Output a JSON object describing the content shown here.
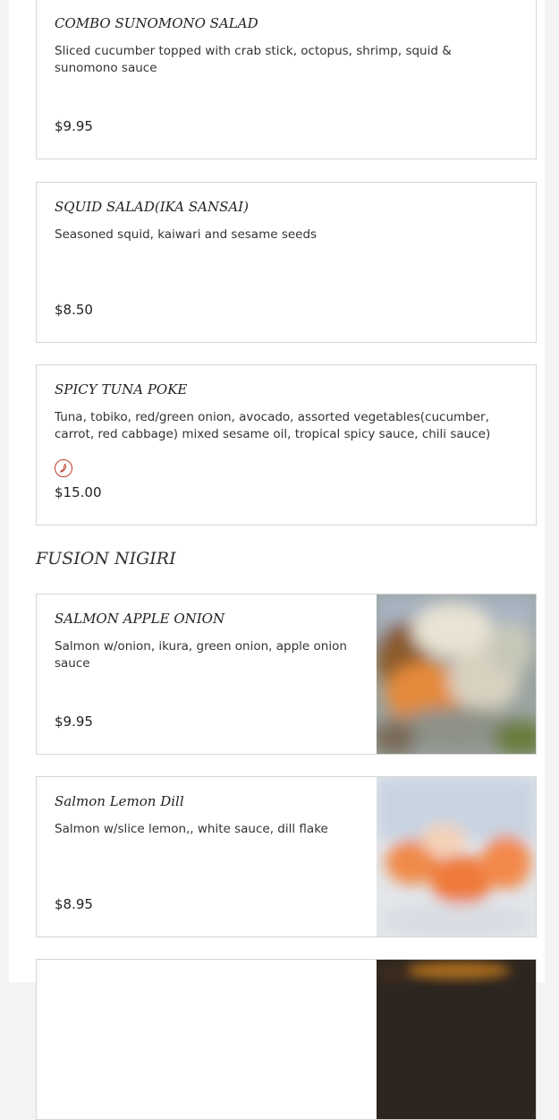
{
  "menu": {
    "items": [
      {
        "title": "COMBO SUNOMONO SALAD",
        "description": "Sliced cucumber topped with crab stick, octopus, shrimp, squid & sunomono sauce",
        "price": "$9.95"
      },
      {
        "title": "SQUID SALAD(IKA SANSAI)",
        "description": "Seasoned squid, kaiwari and sesame seeds",
        "price": "$8.50"
      },
      {
        "title": "SPICY TUNA POKE",
        "description": "Tuna, tobiko, red/green onion, avocado, assorted vegetables(cucumber, carrot, red cabbage) mixed sesame oil, tropical spicy sauce, chili sauce)",
        "price": "$15.00",
        "icon": "spicy-pepper-icon"
      }
    ],
    "section": {
      "title": "FUSION NIGIRI",
      "items": [
        {
          "title": "SALMON APPLE ONION",
          "description": "Salmon w/onion, ikura, green onion, apple onion sauce",
          "price": "$9.95"
        },
        {
          "title": "Salmon Lemon Dill",
          "description": "Salmon w/slice lemon,, white sauce, dill flake",
          "price": "$8.95"
        },
        {
          "title": "",
          "description": "",
          "price": ""
        }
      ]
    }
  },
  "colors": {
    "border": "#d5d5d5",
    "spicy": "#c0392b",
    "background": "#f3f3f3"
  }
}
